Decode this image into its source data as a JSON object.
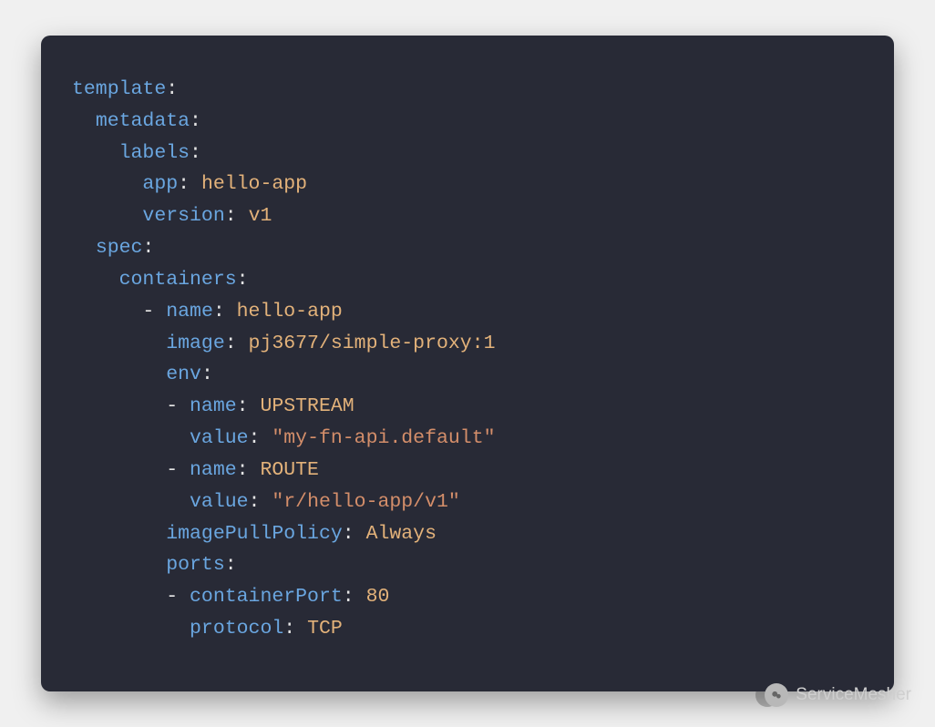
{
  "code": {
    "template": "template",
    "metadata": "metadata",
    "labels": "labels",
    "app_key": "app",
    "app_val": "hello-app",
    "version_key": "version",
    "version_val": "v1",
    "spec": "spec",
    "containers": "containers",
    "name_key": "name",
    "name_val": "hello-app",
    "image_key": "image",
    "image_val": "pj3677/simple-proxy:1",
    "env": "env",
    "env1_name_key": "name",
    "env1_name_val": "UPSTREAM",
    "env1_value_key": "value",
    "env1_value_val": "\"my-fn-api.default\"",
    "env2_name_key": "name",
    "env2_name_val": "ROUTE",
    "env2_value_key": "value",
    "env2_value_val": "\"r/hello-app/v1\"",
    "imagePullPolicy_key": "imagePullPolicy",
    "imagePullPolicy_val": "Always",
    "ports": "ports",
    "containerPort_key": "containerPort",
    "containerPort_val": "80",
    "protocol_key": "protocol",
    "protocol_val": "TCP"
  },
  "watermark": {
    "label": "ServiceMesher"
  }
}
